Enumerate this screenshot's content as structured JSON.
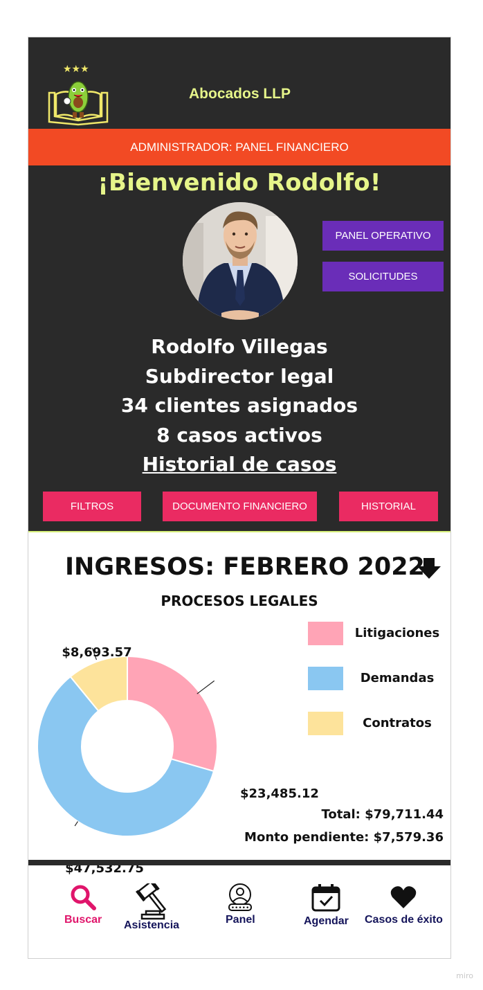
{
  "header": {
    "brand": "Abocados LLP",
    "admin_bar": "ADMINISTRADOR: PANEL FINANCIERO",
    "welcome": "¡Bienvenido Rodolfo!"
  },
  "profile": {
    "name": "Rodolfo Villegas",
    "role": "Subdirector legal",
    "clients": "34 clientes asignados",
    "cases": "8 casos activos",
    "history_link": "Historial de casos"
  },
  "side_buttons": {
    "operational": "PANEL OPERATIVO",
    "requests": "SOLICITUDES"
  },
  "action_buttons": {
    "filters": "FILTROS",
    "financial_doc": "DOCUMENTO FINANCIERO",
    "history": "HISTORIAL"
  },
  "income": {
    "title": "INGRESOS: FEBRERO 2022",
    "chart_title": "PROCESOS LEGALES",
    "total": "Total: $79,711.44",
    "pending": "Monto pendiente: $7,579.36"
  },
  "chart_data": {
    "type": "pie",
    "title": "PROCESOS LEGALES",
    "categories": [
      "Litigaciones",
      "Demandas",
      "Contratos"
    ],
    "values": [
      23485.12,
      47532.75,
      8693.57
    ],
    "value_labels": [
      "$23,485.12",
      "$47,532.75",
      "$8,693.57"
    ],
    "colors": [
      "#ffa4b6",
      "#8ac7f1",
      "#fde39b"
    ],
    "legend": "right",
    "donut": true
  },
  "nav": {
    "items": [
      {
        "label": "Buscar",
        "icon": "search-icon",
        "active": true
      },
      {
        "label": "Asistencia",
        "icon": "gavel-icon",
        "active": false
      },
      {
        "label": "Panel",
        "icon": "user-login-icon",
        "active": false
      },
      {
        "label": "Agendar",
        "icon": "calendar-check-icon",
        "active": false
      },
      {
        "label": "Casos de éxito",
        "icon": "heart-icon",
        "active": false
      }
    ]
  },
  "colors": {
    "dark_bg": "#2a2a2a",
    "accent_yellow": "#e6f58a",
    "admin_orange": "#f24a24",
    "purple": "#6a2db8",
    "pink": "#ea2b62",
    "nav_active": "#e0156b",
    "nav_text": "#14145a"
  },
  "watermark": "miro"
}
